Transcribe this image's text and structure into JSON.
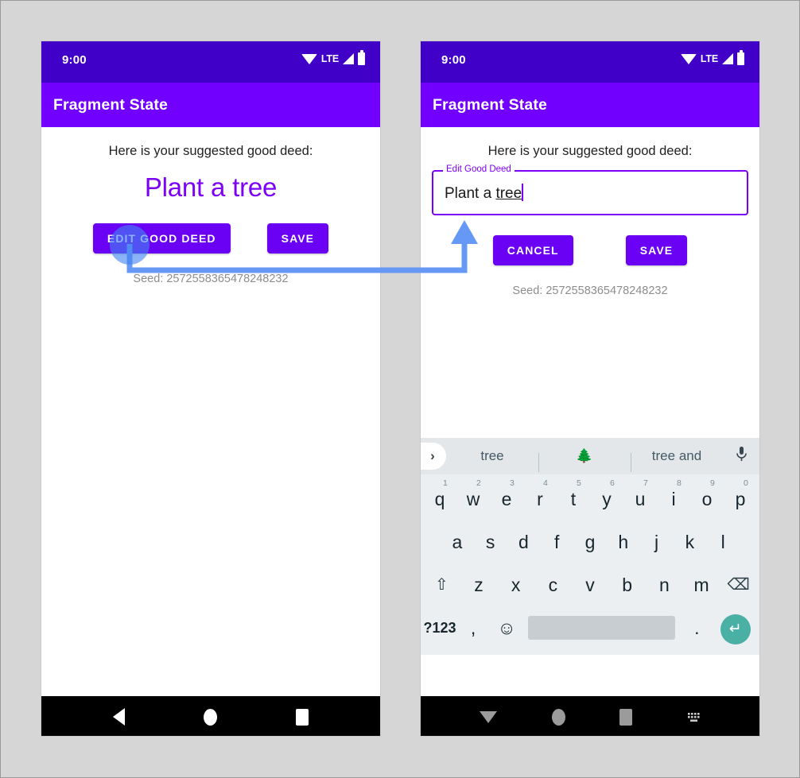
{
  "colors": {
    "status_bar": "#4100c8",
    "app_bar": "#7100ff",
    "accent_purple": "#7c00f5",
    "button_purple": "#6a00f4",
    "annotation_blue": "#6699f5",
    "enter_key_teal": "#4aafa4",
    "page_background": "#d6d6d6"
  },
  "phones": [
    {
      "id": "left",
      "status_bar": {
        "time": "9:00",
        "icons": [
          "wifi-icon",
          "lte-label",
          "signal-icon",
          "battery-icon"
        ],
        "lte_label": "LTE"
      },
      "app_bar": {
        "title": "Fragment State"
      },
      "content": {
        "prompt": "Here is your suggested good deed:",
        "deed": "Plant a tree",
        "buttons": [
          {
            "name": "edit-good-deed-button",
            "label": "EDIT GOOD DEED"
          },
          {
            "name": "save-button",
            "label": "SAVE"
          }
        ],
        "seed": "Seed: 2572558365478248232"
      },
      "nav_bar": {
        "items": [
          "back-icon",
          "home-icon",
          "recents-icon"
        ]
      }
    },
    {
      "id": "right",
      "status_bar": {
        "time": "9:00",
        "icons": [
          "wifi-icon",
          "lte-label",
          "signal-icon",
          "battery-icon"
        ],
        "lte_label": "LTE"
      },
      "app_bar": {
        "title": "Fragment State"
      },
      "content": {
        "prompt": "Here is your suggested good deed:",
        "textfield": {
          "label": "Edit Good Deed",
          "value_prefix": "Plant a ",
          "value_composing": "tree"
        },
        "buttons": [
          {
            "name": "cancel-button",
            "label": "CANCEL"
          },
          {
            "name": "save-button",
            "label": "SAVE"
          }
        ],
        "seed": "Seed: 2572558365478248232"
      },
      "keyboard": {
        "suggestions": [
          "tree",
          "🌲",
          "tree and"
        ],
        "expand_icon": "›",
        "mic_icon": "🎙",
        "row1": [
          {
            "key": "q",
            "num": "1"
          },
          {
            "key": "w",
            "num": "2"
          },
          {
            "key": "e",
            "num": "3"
          },
          {
            "key": "r",
            "num": "4"
          },
          {
            "key": "t",
            "num": "5"
          },
          {
            "key": "y",
            "num": "6"
          },
          {
            "key": "u",
            "num": "7"
          },
          {
            "key": "i",
            "num": "8"
          },
          {
            "key": "o",
            "num": "9"
          },
          {
            "key": "p",
            "num": "0"
          }
        ],
        "row2": [
          "a",
          "s",
          "d",
          "f",
          "g",
          "h",
          "j",
          "k",
          "l"
        ],
        "row3": [
          "⇧",
          "z",
          "x",
          "c",
          "v",
          "b",
          "n",
          "m",
          "⌫"
        ],
        "row4": {
          "sym": "?123",
          "comma": ",",
          "emoji": "☺",
          "space": "",
          "period": ".",
          "enter": "↵"
        }
      },
      "nav_bar": {
        "items": [
          "down-icon",
          "home-icon",
          "recents-icon",
          "keyboard-icon"
        ]
      }
    }
  ],
  "annotation": {
    "type": "click-to-result-arrow",
    "source": "edit-good-deed-button",
    "target": "edit-good-deed-textfield"
  }
}
